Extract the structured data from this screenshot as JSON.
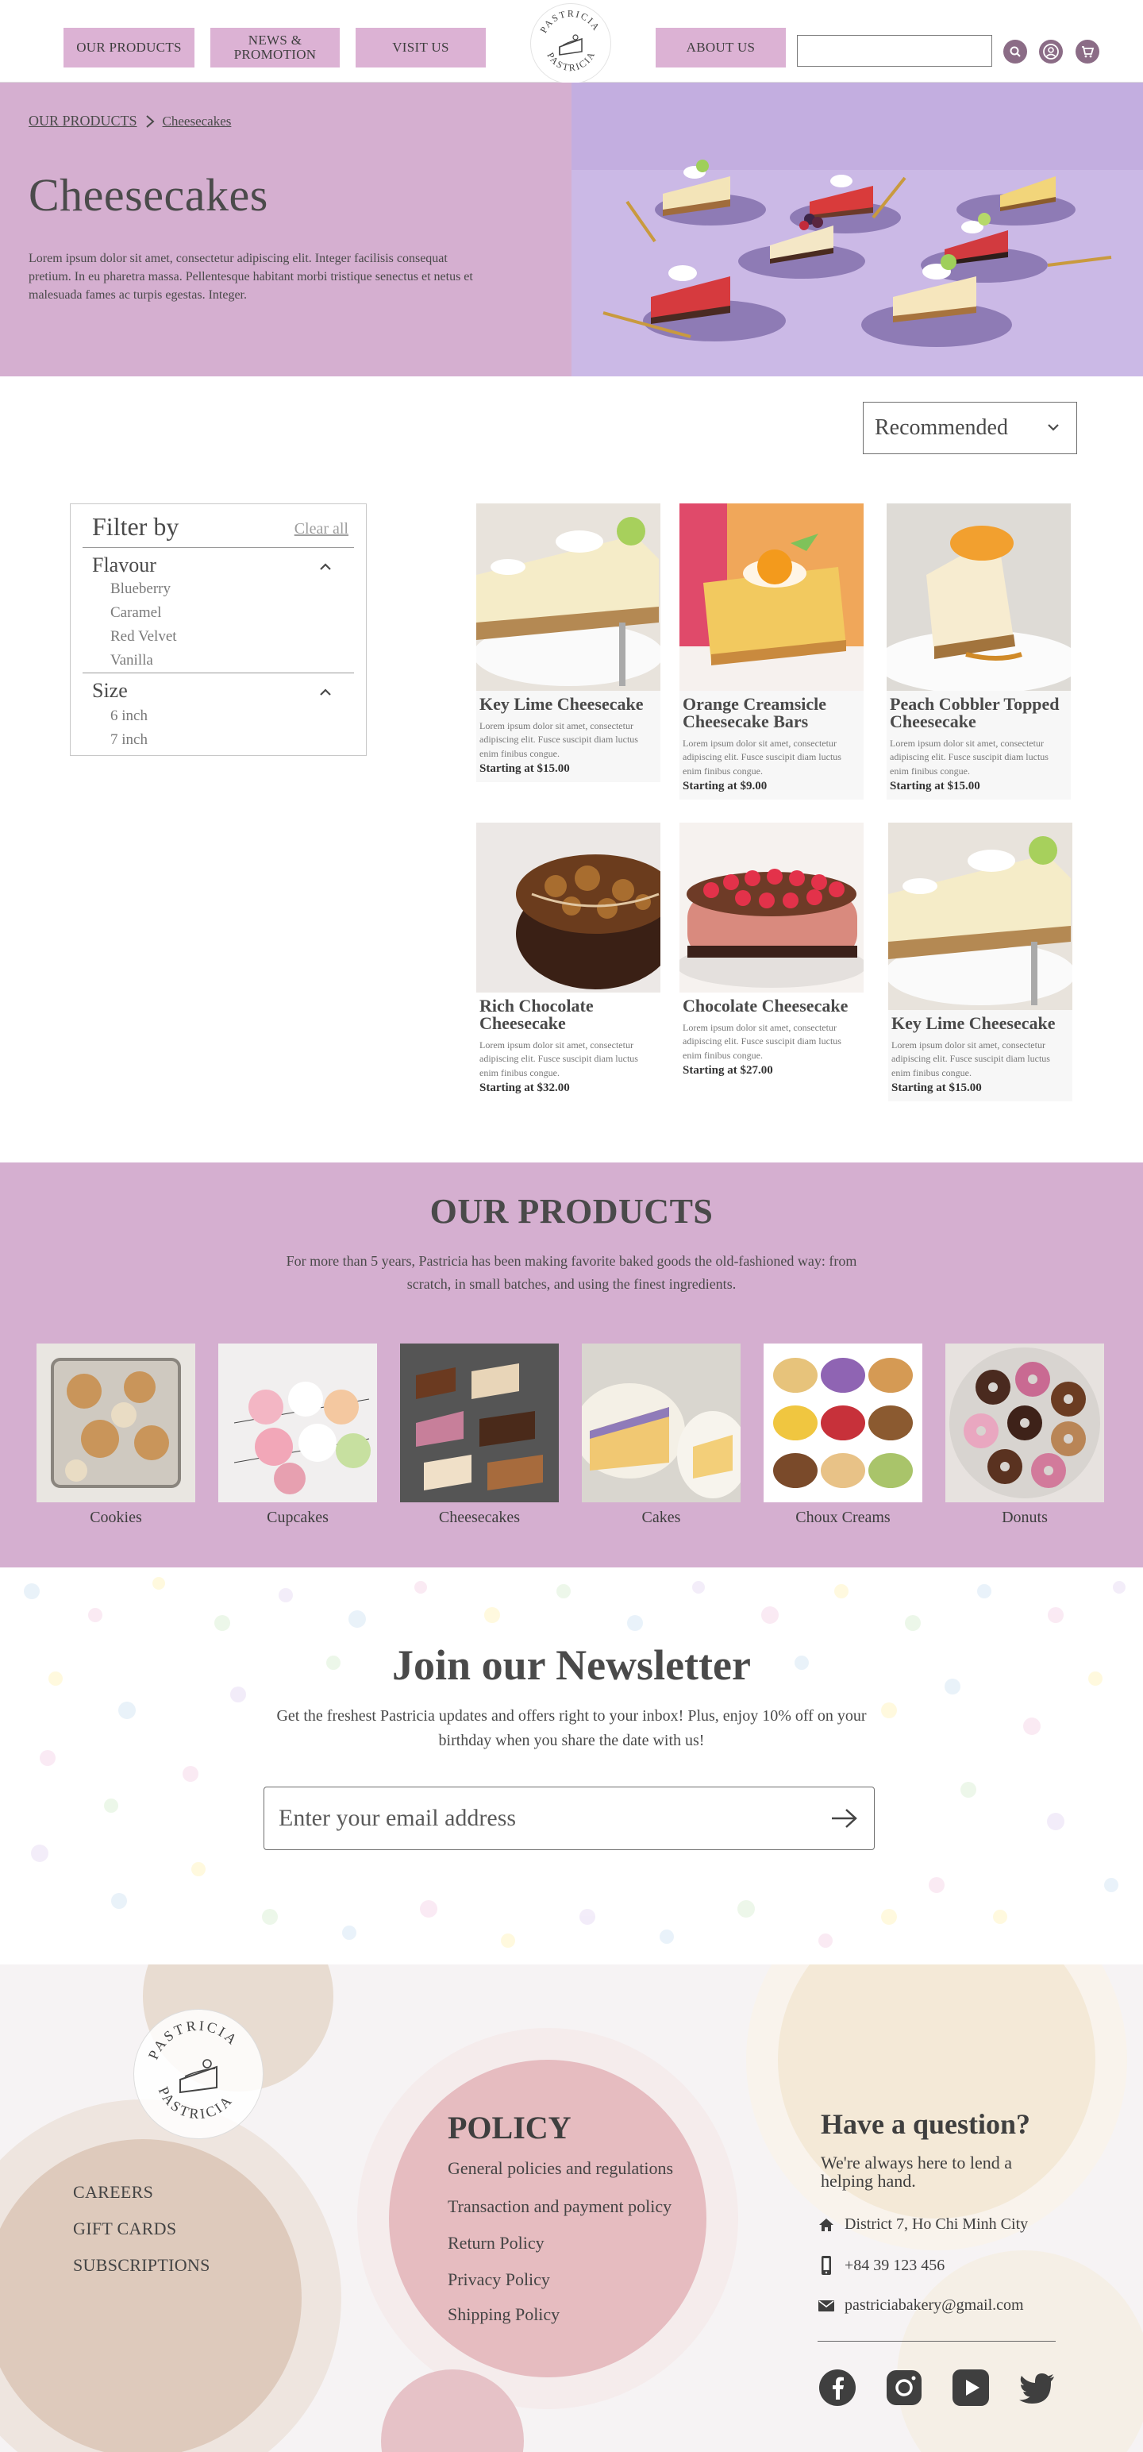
{
  "header": {
    "nav": [
      "OUR PRODUCTS",
      "NEWS & PROMOTION",
      "VISIT US",
      "ABOUT US"
    ],
    "logo_text": "PASTRICIA",
    "search_placeholder": "",
    "icons": [
      "search-icon",
      "user-icon",
      "cart-icon"
    ]
  },
  "hero": {
    "breadcrumb": [
      "OUR PRODUCTS",
      "Cheesecakes"
    ],
    "title": "Cheesecakes",
    "description": "Lorem ipsum dolor sit amet, consectetur adipiscing elit. Integer facilisis consequat pretium. In eu pharetra massa. Pellentesque habitant morbi tristique senectus et netus et malesuada fames ac turpis egestas. Integer."
  },
  "sort": {
    "selected": "Recommended"
  },
  "filter": {
    "title": "Filter by",
    "clear_all": "Clear all",
    "groups": [
      {
        "title": "Flavour",
        "options": [
          "Blueberry",
          "Caramel",
          "Red Velvet",
          "Vanilla"
        ]
      },
      {
        "title": "Size",
        "options": [
          "6 inch",
          "7 inch"
        ]
      }
    ]
  },
  "products": [
    {
      "name": "Key Lime Cheesecake",
      "desc": "Lorem ipsum dolor sit amet, consectetur adipiscing elit. Fusce suscipit diam luctus enim finibus congue.",
      "price": "Starting at $15.00"
    },
    {
      "name": "Orange Creamsicle Cheesecake Bars",
      "desc": "Lorem ipsum dolor sit amet, consectetur adipiscing elit. Fusce suscipit diam luctus enim finibus congue.",
      "price": "Starting at $9.00"
    },
    {
      "name": "Peach Cobbler Topped Cheesecake",
      "desc": "Lorem ipsum dolor sit amet, consectetur adipiscing elit. Fusce suscipit diam luctus enim finibus congue.",
      "price": "Starting at $15.00"
    },
    {
      "name": "Rich Chocolate Cheesecake",
      "desc": "Lorem ipsum dolor sit amet, consectetur adipiscing elit. Fusce suscipit diam luctus enim finibus congue.",
      "price": "Starting at $32.00"
    },
    {
      "name": "Chocolate Cheesecake",
      "desc": "Lorem ipsum dolor sit amet, consectetur adipiscing elit. Fusce suscipit diam luctus enim finibus congue.",
      "price": "Starting at $27.00"
    },
    {
      "name": "Key Lime Cheesecake",
      "desc": "Lorem ipsum dolor sit amet, consectetur adipiscing elit. Fusce suscipit diam luctus enim finibus congue.",
      "price": "Starting at $15.00"
    }
  ],
  "our_products": {
    "title": "OUR PRODUCTS",
    "description": "For more than 5 years, Pastricia has been making favorite baked goods the old-fashioned way: from scratch, in small batches, and using the finest ingredients.",
    "categories": [
      "Cookies",
      "Cupcakes",
      "Cheesecakes",
      "Cakes",
      "Choux Creams",
      "Donuts"
    ]
  },
  "newsletter": {
    "title": "Join our Newsletter",
    "description": "Get the freshest Pastricia updates and offers right to your inbox! Plus, enjoy 10% off on your birthday when you share the date with us!",
    "placeholder": "Enter your email address"
  },
  "footer": {
    "links": [
      "CAREERS",
      "GIFT CARDS",
      "SUBSCRIPTIONS"
    ],
    "policy_title": "POLICY",
    "policies": [
      "General policies and regulations",
      "Transaction and payment policy",
      "Return Policy",
      "Privacy Policy",
      "Shipping Policy"
    ],
    "question_title": "Have a question?",
    "question_sub": "We're always here to lend a helping hand.",
    "address": "District 7, Ho Chi Minh City",
    "phone": "+84 39 123 456",
    "email": "pastriciabakery@gmail.com",
    "social": [
      "facebook-icon",
      "instagram-icon",
      "youtube-icon",
      "twitter-icon"
    ]
  },
  "colors": {
    "accent": "#d5afd0",
    "nav_button": "#dcb2d4",
    "icon": "#8b6c86",
    "text": "#4a4a4a"
  }
}
